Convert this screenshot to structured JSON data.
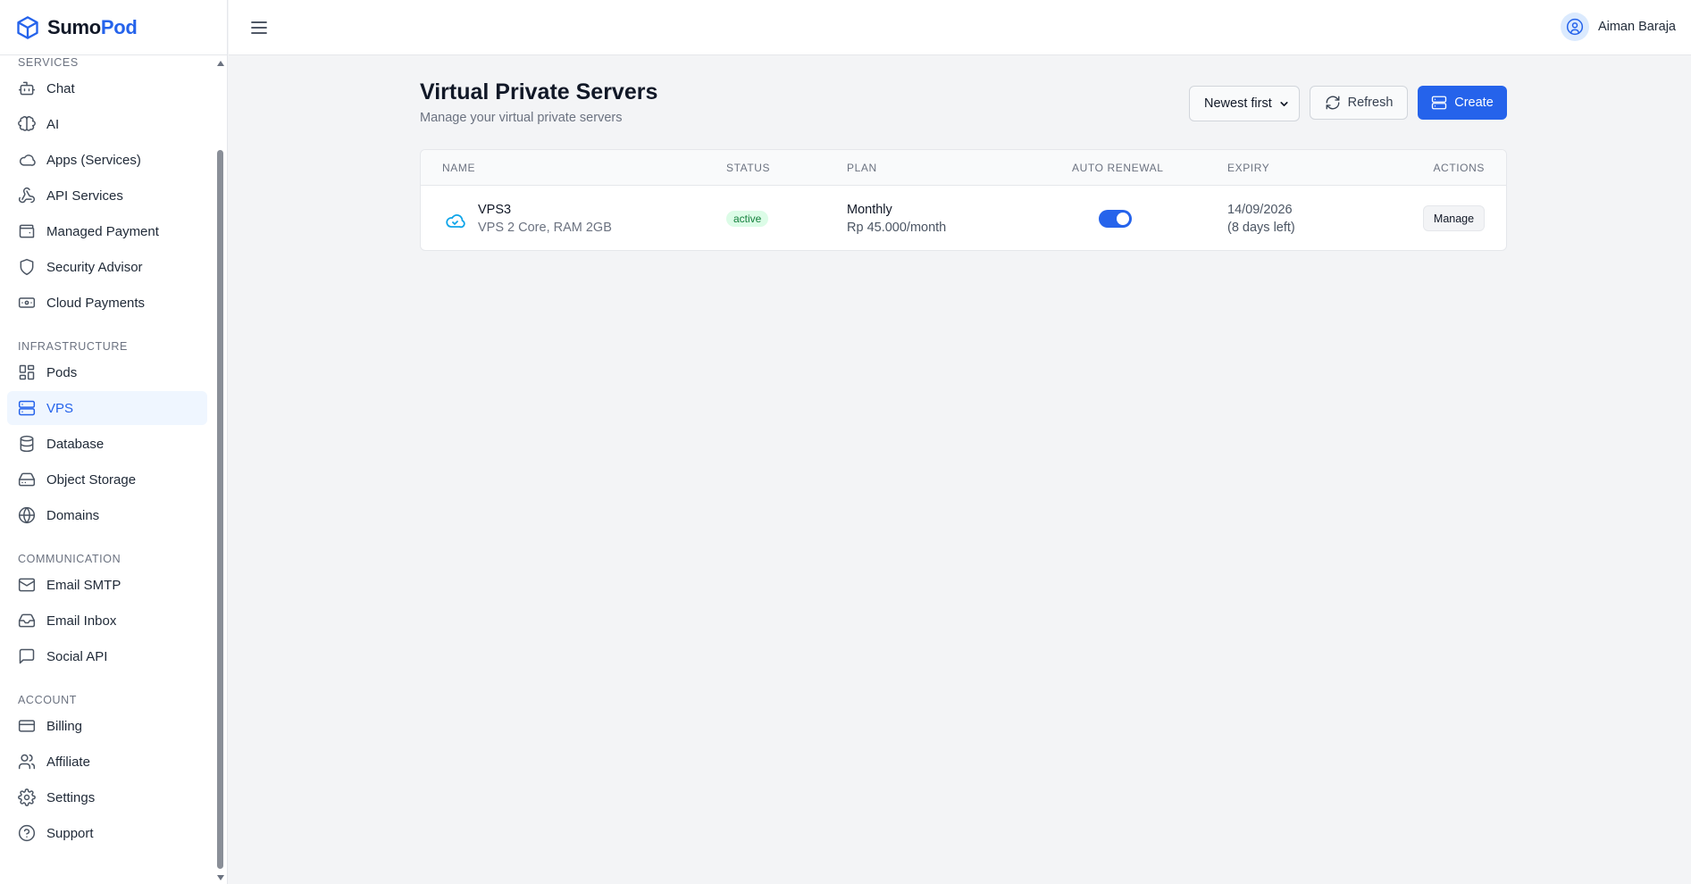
{
  "brand": {
    "part1": "Sumo",
    "part2": "Pod",
    "icon": "cube-icon"
  },
  "user": {
    "name": "Aiman Baraja",
    "icon": "user-circle-icon"
  },
  "sidebar": {
    "sections": [
      {
        "title": "SERVICES",
        "items": [
          {
            "label": "Chat",
            "icon": "bot-icon"
          },
          {
            "label": "AI",
            "icon": "brain-icon"
          },
          {
            "label": "Apps (Services)",
            "icon": "cloud-icon"
          },
          {
            "label": "API Services",
            "icon": "webhook-icon"
          },
          {
            "label": "Managed Payment",
            "icon": "wallet-icon"
          },
          {
            "label": "Security Advisor",
            "icon": "shield-icon"
          },
          {
            "label": "Cloud Payments",
            "icon": "banknote-icon"
          }
        ]
      },
      {
        "title": "INFRASTRUCTURE",
        "items": [
          {
            "label": "Pods",
            "icon": "grid-icon"
          },
          {
            "label": "VPS",
            "icon": "server-icon",
            "active": true
          },
          {
            "label": "Database",
            "icon": "database-icon"
          },
          {
            "label": "Object Storage",
            "icon": "hard-drive-icon"
          },
          {
            "label": "Domains",
            "icon": "globe-icon"
          }
        ]
      },
      {
        "title": "COMMUNICATION",
        "items": [
          {
            "label": "Email SMTP",
            "icon": "mail-icon"
          },
          {
            "label": "Email Inbox",
            "icon": "inbox-icon"
          },
          {
            "label": "Social API",
            "icon": "message-square-icon"
          }
        ]
      },
      {
        "title": "ACCOUNT",
        "items": [
          {
            "label": "Billing",
            "icon": "credit-card-icon"
          },
          {
            "label": "Affiliate",
            "icon": "users-icon"
          },
          {
            "label": "Settings",
            "icon": "gear-icon"
          },
          {
            "label": "Support",
            "icon": "help-circle-icon"
          }
        ]
      }
    ]
  },
  "page": {
    "title": "Virtual Private Servers",
    "subtitle": "Manage your virtual private servers",
    "sort": {
      "selected": "Newest first"
    },
    "refresh_label": "Refresh",
    "create_label": "Create"
  },
  "table": {
    "headers": {
      "name": "NAME",
      "status": "STATUS",
      "plan": "PLAN",
      "auto_renewal": "AUTO RENEWAL",
      "expiry": "EXPIRY",
      "actions": "ACTIONS"
    },
    "rows": [
      {
        "name": "VPS3",
        "spec": "VPS 2 Core, RAM 2GB",
        "status": "active",
        "plan": "Monthly",
        "price": "Rp 45.000/month",
        "auto_renewal": true,
        "expiry_date": "14/09/2026",
        "expiry_left": "(8 days left)",
        "action_label": "Manage",
        "icon": "cloud-icon"
      }
    ]
  },
  "colors": {
    "accent": "#2563eb",
    "status_active_bg": "#dcfce7",
    "status_active_text": "#15803d"
  }
}
